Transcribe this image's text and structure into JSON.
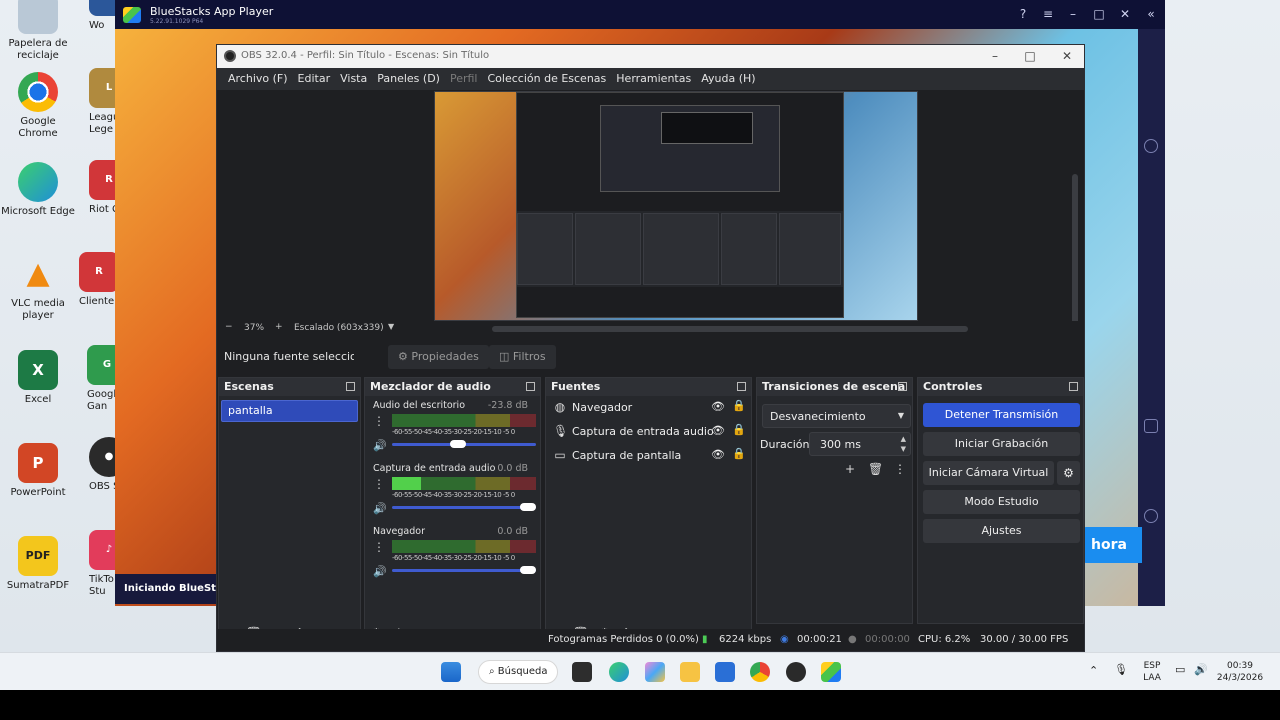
{
  "desktop": {
    "icons": [
      {
        "label": "Papelera de reciclaje",
        "icon": "recycle-bin-icon",
        "color": "#9fb4c8"
      },
      {
        "label": "Google Chrome",
        "icon": "chrome-icon",
        "color": "#e8453c"
      },
      {
        "label": "Microsoft Edge",
        "icon": "edge-icon",
        "color": "#1f8fd8"
      },
      {
        "label": "VLC media player",
        "icon": "vlc-icon",
        "color": "#f08a11"
      },
      {
        "label": "Excel",
        "icon": "excel-icon",
        "color": "#1d7a45"
      },
      {
        "label": "PowerPoint",
        "icon": "powerpoint-icon",
        "color": "#d24625"
      },
      {
        "label": "SumatraPDF",
        "icon": "sumatrapdf-icon",
        "color": "#f3c61c"
      }
    ],
    "icons_col2": [
      {
        "label": "Wo",
        "icon": "word-icon",
        "color": "#2b579a"
      },
      {
        "label": "Leagu Lege",
        "icon": "league-icon",
        "color": "#b08a3e"
      },
      {
        "label": "Riot C",
        "icon": "riot-icon",
        "color": "#d13639"
      },
      {
        "label": "Cliente",
        "icon": "riot-client-icon",
        "color": "#d13639"
      },
      {
        "label": "Googl Gan",
        "icon": "google-games-icon",
        "color": "#2f9b4d"
      },
      {
        "label": "OBS S",
        "icon": "obs-icon",
        "color": "#2a2a2a"
      },
      {
        "label": "TikTo Stu",
        "icon": "tiktok-icon",
        "color": "#e23c5b"
      }
    ]
  },
  "bluestacks": {
    "title": "BlueStacks App Player",
    "version": "5.22.91.1029 P64",
    "loading": "Iniciando BlueStacks",
    "button": "hora"
  },
  "obs": {
    "title": "OBS 32.0.4 - Perfil: Sin Título - Escenas: Sin Título",
    "menu": [
      "Archivo (F)",
      "Editar",
      "Vista",
      "Paneles (D)",
      "Perfil",
      "Colección de Escenas",
      "Herramientas",
      "Ayuda (H)"
    ],
    "zoom": {
      "minus": "−",
      "value": "37%",
      "plus": "+",
      "scale": "Escalado (603x339)"
    },
    "no_source": "Ninguna fuente seleccionada",
    "properties": "Propiedades",
    "filters": "Filtros",
    "scenes": {
      "title": "Escenas",
      "items": [
        "pantalla"
      ]
    },
    "mixer": {
      "title": "Mezclador de audio",
      "scale": "-60-55-50-45-40-35-30-25-20-15-10 -5  0",
      "channels": [
        {
          "name": "Audio del escritorio",
          "db": "-23.8 dB",
          "level": 0.0,
          "volume": 0.45
        },
        {
          "name": "Captura de entrada audio",
          "db": "0.0 dB",
          "level": 0.2,
          "volume": 1.0
        },
        {
          "name": "Navegador",
          "db": "0.0 dB",
          "level": 0.0,
          "volume": 1.0
        }
      ]
    },
    "sources": {
      "title": "Fuentes",
      "items": [
        {
          "name": "Navegador",
          "icon": "globe-icon"
        },
        {
          "name": "Captura de entrada audio",
          "icon": "microphone-icon"
        },
        {
          "name": "Captura de pantalla",
          "icon": "monitor-icon"
        }
      ]
    },
    "transitions": {
      "title": "Transiciones de escena",
      "selected": "Desvanecimiento",
      "duration_label": "Duración",
      "duration": "300 ms"
    },
    "controls": {
      "title": "Controles",
      "stop_stream": "Detener Transmisión",
      "start_recording": "Iniciar Grabación",
      "virtual_cam": "Iniciar Cámara Virtual",
      "studio_mode": "Modo Estudio",
      "settings": "Ajustes"
    },
    "status": {
      "dropped": "Fotogramas Perdidos 0 (0.0%)",
      "bitrate": "6224 kbps",
      "stream_time": "00:00:21",
      "rec_time": "00:00:00",
      "cpu": "CPU: 6.2%",
      "fps": "30.00 / 30.00 FPS"
    },
    "accent": "#2f55d4"
  },
  "taskbar": {
    "search": "Búsqueda",
    "lang": "ESP",
    "lang2": "LAA",
    "time": "00:39",
    "date": "24/3/2026"
  }
}
